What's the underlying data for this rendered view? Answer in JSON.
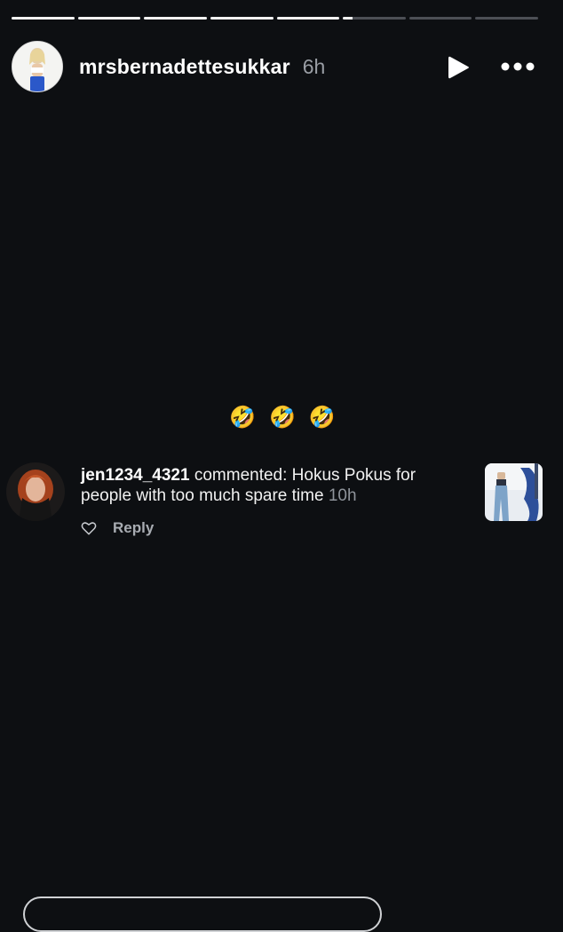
{
  "story": {
    "progress_segments": [
      1,
      1,
      1,
      1,
      1,
      0.15,
      0,
      0
    ],
    "username": "mrsbernadettesukkar",
    "time_ago": "6h"
  },
  "icons": {
    "play": "play-icon",
    "more": "more-dots-icon",
    "heart": "heart-outline-icon",
    "reaction": "rolling-on-floor-laughing-emoji"
  },
  "reaction": {
    "emojis": [
      "🤣",
      "🤣",
      "🤣"
    ]
  },
  "comment": {
    "username": "jen1234_4321",
    "prefix": "commented:",
    "text": "Hokus Pokus for people with too much spare time",
    "time_ago": "10h",
    "reply_label": "Reply"
  },
  "colors": {
    "background": "#0d0f12",
    "progress_done": "#f2f2f2",
    "progress_pending": "#4c4f55",
    "muted_text": "#9a9ea5"
  }
}
